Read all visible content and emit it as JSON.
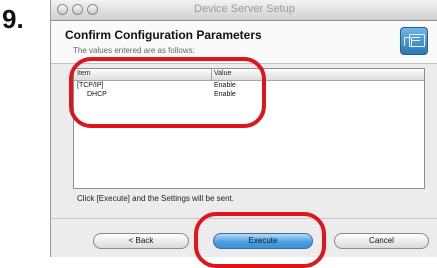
{
  "step_number": "9.",
  "window": {
    "title": "Device Server Setup"
  },
  "header": {
    "title": "Confirm Configuration Parameters",
    "subtitle": "The values entered are as follows:"
  },
  "table": {
    "columns": [
      "Item",
      "Value"
    ],
    "rows": [
      {
        "item": "[TCP/IP]",
        "value": "Enable"
      },
      {
        "item": "DHCP",
        "value": "Enable"
      }
    ]
  },
  "footer_text": "Click [Execute] and the Settings will be sent.",
  "buttons": {
    "back": "< Back",
    "execute": "Execute",
    "cancel": "Cancel"
  },
  "colors": {
    "callout": "#e0151c",
    "primary_button": "#4e9ee0"
  }
}
